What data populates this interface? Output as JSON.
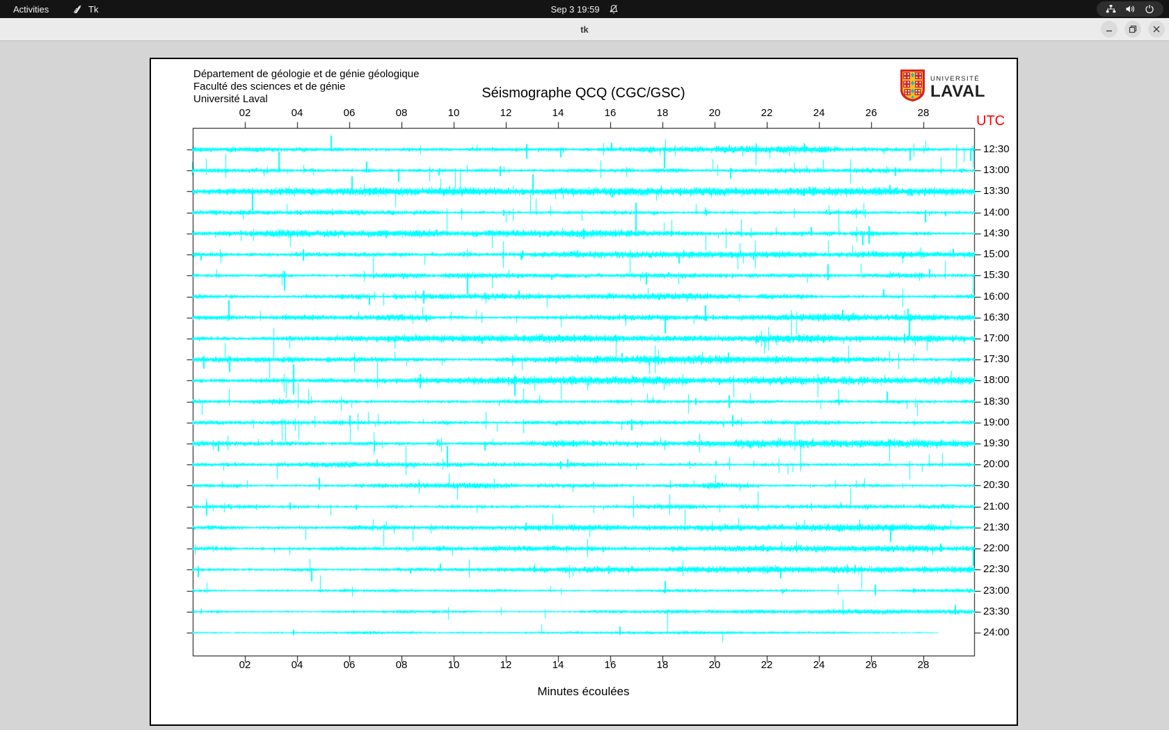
{
  "topbar": {
    "activities": "Activities",
    "app_name": "Tk",
    "clock": "Sep 3  19:59"
  },
  "window": {
    "title": "tk"
  },
  "header": {
    "institution_lines": "Département de géologie et de génie géologique\nFaculté des sciences et de génie\nUniversité Laval",
    "title": "Séismographe QCQ (CGC/GSC)",
    "logo_line1": "UNIVERSITÉ",
    "logo_line2": "LAVAL"
  },
  "plot": {
    "utc_label": "UTC",
    "xlabel": "Minutes écoulées",
    "x_ticks": [
      "02",
      "04",
      "06",
      "08",
      "10",
      "12",
      "14",
      "16",
      "18",
      "20",
      "22",
      "24",
      "26",
      "28"
    ],
    "x_tick_minutes": [
      2,
      4,
      6,
      8,
      10,
      12,
      14,
      16,
      18,
      20,
      22,
      24,
      26,
      28
    ]
  },
  "chart_data": {
    "type": "seismogram-helicorder",
    "title": "Séismographe QCQ (CGC/GSC)",
    "xlabel": "Minutes écoulées",
    "x_range_minutes": [
      0,
      30
    ],
    "trace_color": "#00ffff",
    "axis_color": "#000000",
    "utc_color": "#ff0000",
    "rows": [
      {
        "label": "12:30",
        "amp": 2.8,
        "spikes": 34,
        "end_minute": 29.95
      },
      {
        "label": "13:00",
        "amp": 2.6,
        "spikes": 38,
        "end_minute": 29.95
      },
      {
        "label": "13:30",
        "amp": 2.8,
        "spikes": 30,
        "end_minute": 29.95
      },
      {
        "label": "14:00",
        "amp": 2.5,
        "spikes": 30,
        "end_minute": 29.95
      },
      {
        "label": "14:30",
        "amp": 2.5,
        "spikes": 26,
        "end_minute": 29.95
      },
      {
        "label": "15:00",
        "amp": 2.6,
        "spikes": 30,
        "end_minute": 29.95
      },
      {
        "label": "15:30",
        "amp": 2.6,
        "spikes": 26,
        "end_minute": 29.95
      },
      {
        "label": "16:00",
        "amp": 2.5,
        "spikes": 24,
        "end_minute": 29.95
      },
      {
        "label": "16:30",
        "amp": 2.6,
        "spikes": 30,
        "end_minute": 29.95
      },
      {
        "label": "17:00",
        "amp": 2.6,
        "spikes": 26,
        "end_minute": 29.95
      },
      {
        "label": "17:30",
        "amp": 2.7,
        "spikes": 28,
        "end_minute": 29.95
      },
      {
        "label": "18:00",
        "amp": 2.7,
        "spikes": 26,
        "end_minute": 29.95
      },
      {
        "label": "18:30",
        "amp": 2.6,
        "spikes": 24,
        "end_minute": 29.95
      },
      {
        "label": "19:00",
        "amp": 2.5,
        "spikes": 26,
        "end_minute": 29.95
      },
      {
        "label": "19:30",
        "amp": 2.6,
        "spikes": 28,
        "end_minute": 29.95
      },
      {
        "label": "20:00",
        "amp": 2.4,
        "spikes": 26,
        "end_minute": 29.95
      },
      {
        "label": "20:30",
        "amp": 2.3,
        "spikes": 22,
        "end_minute": 29.95
      },
      {
        "label": "21:00",
        "amp": 2.3,
        "spikes": 22,
        "end_minute": 29.95
      },
      {
        "label": "21:30",
        "amp": 2.3,
        "spikes": 24,
        "end_minute": 29.95
      },
      {
        "label": "22:00",
        "amp": 2.1,
        "spikes": 18,
        "end_minute": 29.95
      },
      {
        "label": "22:30",
        "amp": 2.2,
        "spikes": 20,
        "end_minute": 29.95
      },
      {
        "label": "23:00",
        "amp": 1.6,
        "spikes": 10,
        "end_minute": 29.95
      },
      {
        "label": "23:30",
        "amp": 1.6,
        "spikes": 8,
        "end_minute": 29.95
      },
      {
        "label": "24:00",
        "amp": 1.1,
        "spikes": 4,
        "end_minute": 28.56
      }
    ]
  }
}
